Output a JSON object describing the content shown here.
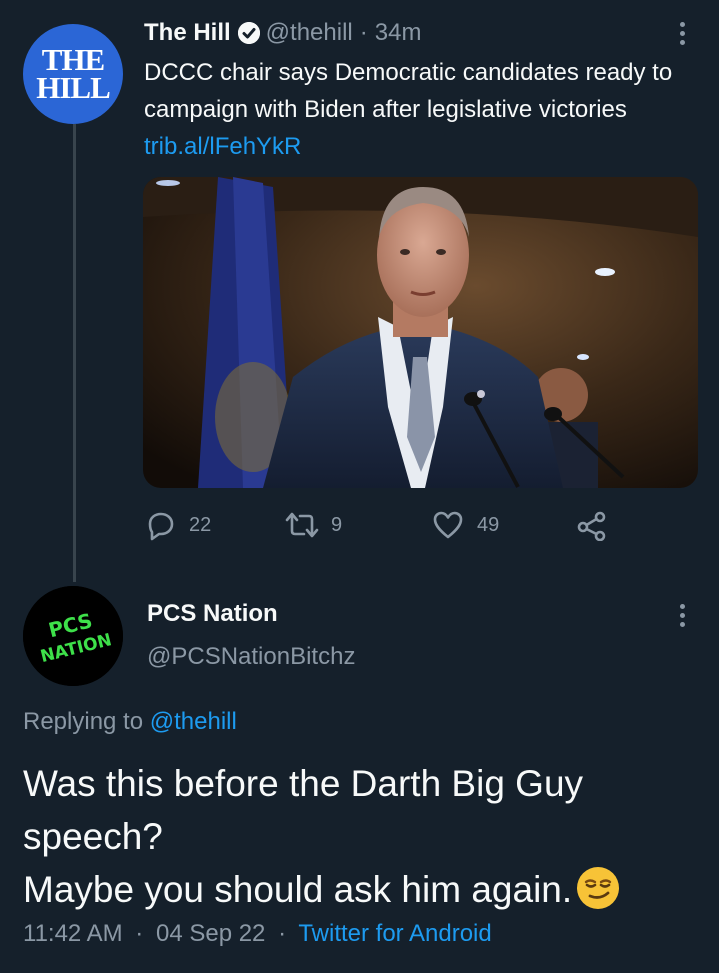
{
  "colors": {
    "background": "#15202b",
    "text": "#f7f9f9",
    "muted": "#8b98a5",
    "link": "#1d9bf0",
    "hill_avatar": "#2b66d6",
    "pcs_neon": "#3ee04a"
  },
  "tweet": {
    "avatar_text_line1": "THE",
    "avatar_text_line2": "HILL",
    "author_name": "The Hill",
    "verified_icon": "verified-badge-icon",
    "handle": "@thehill",
    "separator": "·",
    "time_ago": "34m",
    "text": "DCCC chair says Democratic candidates ready to campaign with Biden after legislative victories",
    "link": "trib.al/lFehYkR",
    "media_alt_icon": "photo-media",
    "stats": {
      "replies": "22",
      "retweets": "9",
      "likes": "49"
    },
    "icons": {
      "reply": "reply-icon",
      "retweet": "retweet-icon",
      "like": "heart-icon",
      "share": "share-icon",
      "more": "more-options-icon"
    }
  },
  "reply": {
    "avatar_text_line1": "PCS",
    "avatar_text_line2": "NATION",
    "author_name": "PCS Nation",
    "handle": "@PCSNationBitchz",
    "replying_prefix": "Replying to",
    "replying_handle": "@thehill",
    "text_line1": "Was this before the Darth Big Guy speech?",
    "text_line2": "Maybe you should ask him again.",
    "emoji_icon": "smirking-face-emoji",
    "time": "11:42 AM",
    "separator": "·",
    "date": "04 Sep 22",
    "separator2": "·",
    "client": "Twitter for Android"
  }
}
